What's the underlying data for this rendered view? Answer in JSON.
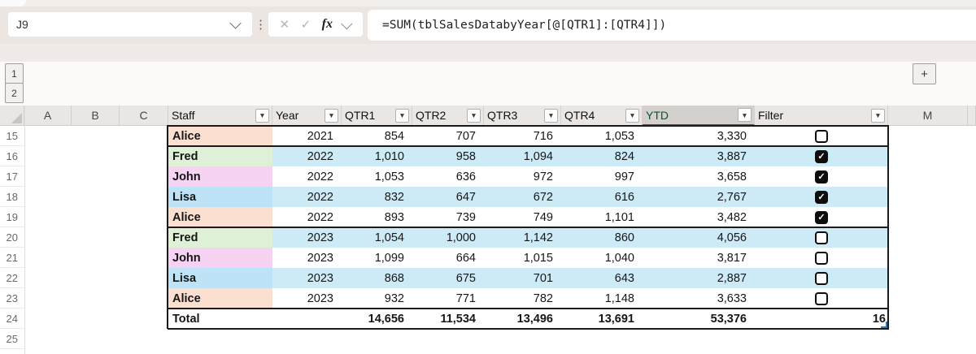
{
  "formula_bar": {
    "name_box_value": "J9",
    "formula": "=SUM(tblSalesDatabyYear[@[QTR1]:[QTR4]])",
    "cancel_icon": "✕",
    "enter_icon": "✓",
    "fx_label": "fx",
    "more_dots": "⋮"
  },
  "outline": {
    "level1_label": "1",
    "level2_label": "2",
    "expand_label": "+"
  },
  "sheet": {
    "column_letters_left": [
      "A",
      "B",
      "C"
    ],
    "column_letter_right": "M",
    "row_numbers": [
      "15",
      "16",
      "17",
      "18",
      "19",
      "20",
      "21",
      "22",
      "23",
      "24",
      "25"
    ]
  },
  "icons": {
    "dropdown_arrow": "▼",
    "check": "✓"
  },
  "table": {
    "headers": [
      "Staff",
      "Year",
      "QTR1",
      "QTR2",
      "QTR3",
      "QTR4",
      "YTD",
      "Filter"
    ],
    "selected_header": "YTD",
    "rows": [
      {
        "row": "15",
        "staff": "Alice",
        "staff_color": "alice",
        "year": "2021",
        "qtr1": "854",
        "qtr2": "707",
        "qtr3": "716",
        "qtr4": "1,053",
        "ytd": "3,330",
        "checked": false,
        "banded": false,
        "group_end": true
      },
      {
        "row": "16",
        "staff": "Fred",
        "staff_color": "fred",
        "year": "2022",
        "qtr1": "1,010",
        "qtr2": "958",
        "qtr3": "1,094",
        "qtr4": "824",
        "ytd": "3,887",
        "checked": true,
        "banded": true,
        "group_end": false
      },
      {
        "row": "17",
        "staff": "John",
        "staff_color": "john",
        "year": "2022",
        "qtr1": "1,053",
        "qtr2": "636",
        "qtr3": "972",
        "qtr4": "997",
        "ytd": "3,658",
        "checked": true,
        "banded": false,
        "group_end": false
      },
      {
        "row": "18",
        "staff": "Lisa",
        "staff_color": "lisa",
        "year": "2022",
        "qtr1": "832",
        "qtr2": "647",
        "qtr3": "672",
        "qtr4": "616",
        "ytd": "2,767",
        "checked": true,
        "banded": true,
        "group_end": false
      },
      {
        "row": "19",
        "staff": "Alice",
        "staff_color": "alice",
        "year": "2022",
        "qtr1": "893",
        "qtr2": "739",
        "qtr3": "749",
        "qtr4": "1,101",
        "ytd": "3,482",
        "checked": true,
        "banded": false,
        "group_end": true
      },
      {
        "row": "20",
        "staff": "Fred",
        "staff_color": "fred",
        "year": "2023",
        "qtr1": "1,054",
        "qtr2": "1,000",
        "qtr3": "1,142",
        "qtr4": "860",
        "ytd": "4,056",
        "checked": false,
        "banded": true,
        "group_end": false
      },
      {
        "row": "21",
        "staff": "John",
        "staff_color": "john",
        "year": "2023",
        "qtr1": "1,099",
        "qtr2": "664",
        "qtr3": "1,015",
        "qtr4": "1,040",
        "ytd": "3,817",
        "checked": false,
        "banded": false,
        "group_end": false
      },
      {
        "row": "22",
        "staff": "Lisa",
        "staff_color": "lisa",
        "year": "2023",
        "qtr1": "868",
        "qtr2": "675",
        "qtr3": "701",
        "qtr4": "643",
        "ytd": "2,887",
        "checked": false,
        "banded": true,
        "group_end": false
      },
      {
        "row": "23",
        "staff": "Alice",
        "staff_color": "alice",
        "year": "2023",
        "qtr1": "932",
        "qtr2": "771",
        "qtr3": "782",
        "qtr4": "1,148",
        "ytd": "3,633",
        "checked": false,
        "banded": false,
        "group_end": true
      }
    ],
    "total_row": {
      "row": "24",
      "label": "Total",
      "year": "",
      "qtr1": "14,656",
      "qtr2": "11,534",
      "qtr3": "13,496",
      "qtr4": "13,691",
      "ytd": "53,376",
      "filter": "16"
    },
    "empty_row": "25"
  },
  "colors": {
    "accent_green": "#107C41",
    "band_blue": "#cdeaf7",
    "staff_alice": "#fbdfd0",
    "staff_fred": "#def0d6",
    "staff_john": "#f6d3f3",
    "staff_lisa": "#bfe3f6",
    "checkbox_black": "#0d0d0d"
  }
}
